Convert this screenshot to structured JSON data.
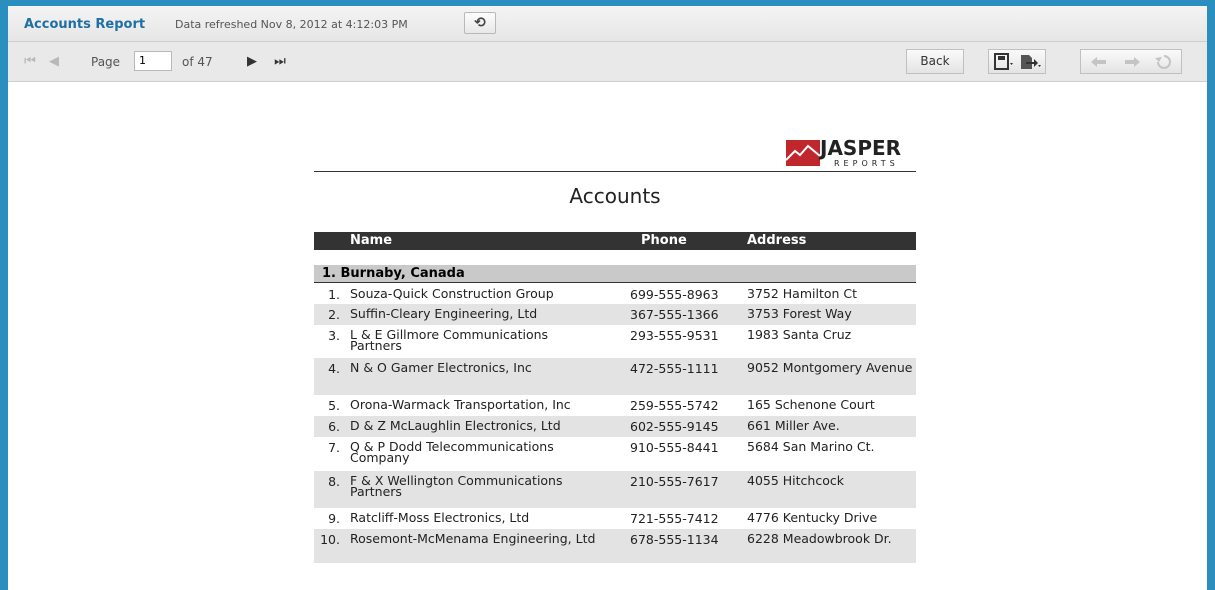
{
  "header": {
    "title": "Accounts Report",
    "refreshed": "Data refreshed Nov 8, 2012 at 4:12:03 PM",
    "refresh_icon": "⟲"
  },
  "toolbar": {
    "page_label": "Page",
    "page_value": "1",
    "of_label": "of 47",
    "back_label": "Back",
    "first_icon": "⏮",
    "prev_icon": "◀",
    "next_icon": "▶",
    "last_icon": "⏭"
  },
  "report": {
    "logo_main": "JASPER",
    "logo_sub": "REPORTS",
    "title": "Accounts",
    "columns": {
      "name": "Name",
      "phone": "Phone",
      "address": "Address"
    },
    "group": "1. Burnaby, Canada",
    "rows": [
      {
        "num": "1.",
        "name": "Souza-Quick Construction Group",
        "phone": "699-555-8963",
        "address": "3752 Hamilton Ct"
      },
      {
        "num": "2.",
        "name": "Suffin-Cleary Engineering, Ltd",
        "phone": "367-555-1366",
        "address": "3753 Forest Way"
      },
      {
        "num": "3.",
        "name": "L & E Gillmore Communications Partners",
        "phone": "293-555-9531",
        "address": "1983 Santa Cruz"
      },
      {
        "num": "4.",
        "name": "N & O Gamer Electronics, Inc",
        "phone": "472-555-1111",
        "address": "9052 Montgomery Avenue"
      },
      {
        "num": "5.",
        "name": "Orona-Warmack Transportation, Inc",
        "phone": "259-555-5742",
        "address": "165 Schenone Court"
      },
      {
        "num": "6.",
        "name": "D & Z McLaughlin Electronics, Ltd",
        "phone": "602-555-9145",
        "address": "661 Miller Ave."
      },
      {
        "num": "7.",
        "name": "Q & P Dodd Telecommunications Company",
        "phone": "910-555-8441",
        "address": "5684 San Marino Ct."
      },
      {
        "num": "8.",
        "name": "F & X Wellington Communications Partners",
        "phone": "210-555-7617",
        "address": "4055 Hitchcock"
      },
      {
        "num": "9.",
        "name": "Ratcliff-Moss Electronics, Ltd",
        "phone": "721-555-7412",
        "address": "4776 Kentucky Drive"
      },
      {
        "num": "10.",
        "name": "Rosemont-McMenama Engineering, Ltd",
        "phone": "678-555-1134",
        "address": "6228 Meadowbrook Dr."
      }
    ]
  },
  "colors": {
    "frame": "#2a8fbf",
    "title": "#1f6fa3",
    "header_bar": "#333333",
    "group_bar": "#c9c9c9",
    "alt_row": "#e3e3e3",
    "logo_red": "#c0272d"
  }
}
